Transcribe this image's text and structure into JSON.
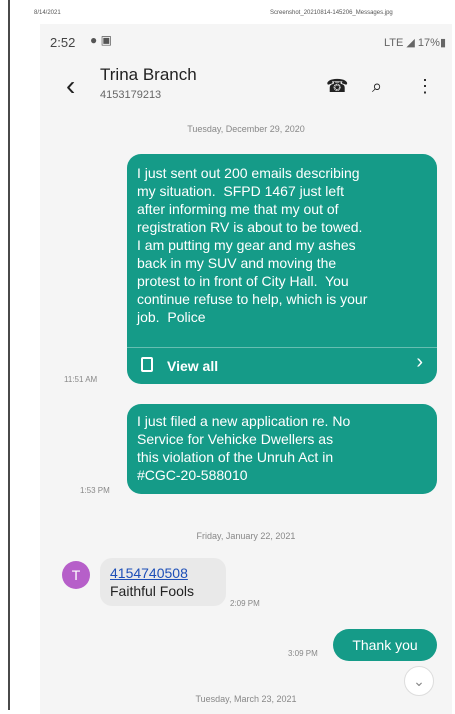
{
  "print_header": {
    "left": "8/14/2021",
    "right": "Screenshot_20210814-145206_Messages.jpg"
  },
  "status_bar": {
    "time": "2:52",
    "icons": "● ▣",
    "right": "LTE ◢ 17%▮"
  },
  "appbar": {
    "back_icon": "‹",
    "contact_name": "Trina Branch",
    "contact_number": "4153179213",
    "call_icon": "☎",
    "search_icon": "⌕",
    "menu_icon": "⋮"
  },
  "conversation": {
    "date_1": "Tuesday, December 29, 2020",
    "msg_1": {
      "text": "I just sent out 200 emails describing\nmy situation.  SFPD 1467 just left\nafter informing me that my out of\nregistration RV is about to be towed.\nI am putting my gear and my ashes\nback in my SUV and moving the\nprotest to in front of City Hall.  You\ncontinue refuse to help, which is your\njob.  Police",
      "view_all": "View all",
      "chevron": "›",
      "time": "11:51 AM"
    },
    "msg_2": {
      "text": "I just filed a new application re. No\nService for Vehicke Dwellers as\nthis violation of the Unruh Act in\n#CGC-20-588010",
      "time": "1:53 PM"
    },
    "date_2": "Friday, January 22, 2021",
    "msg_3": {
      "avatar_letter": "T",
      "avatar_color": "#b65fc9",
      "number": "4154740508",
      "text": "Faithful Fools",
      "time": "2:09 PM"
    },
    "msg_4": {
      "text": "Thank you",
      "time": "3:09 PM"
    },
    "scroll_down_icon": "⌄",
    "date_3": "Tuesday, March 23, 2021"
  },
  "colors": {
    "outgoing_bubble": "#159b88",
    "incoming_bubble": "#e9e9e9",
    "link": "#1d4fb8",
    "background": "#f5f5f5"
  }
}
